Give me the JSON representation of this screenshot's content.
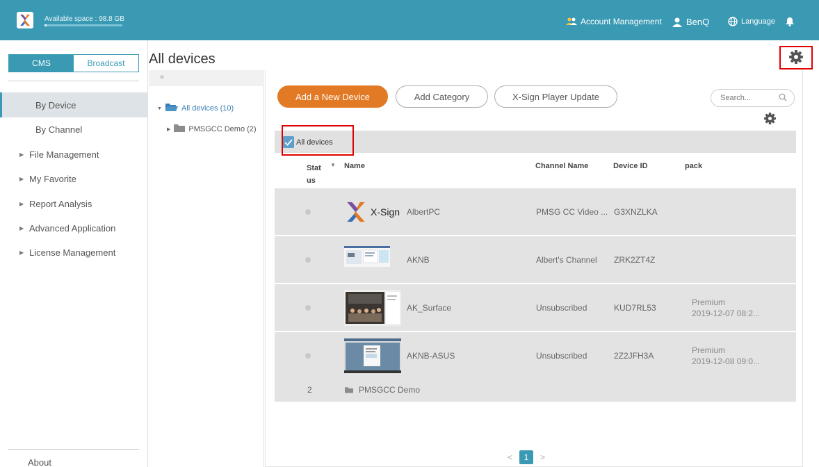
{
  "topbar": {
    "available_space": "Available space : 98.8 GB",
    "space_used_fraction": 0.03,
    "account_management": "Account Management",
    "user": "BenQ",
    "language": "Language",
    "colors": {
      "bar": "#3a9ab4",
      "accent": "#e27924"
    },
    "icons": {
      "logo": "x-sign-logo-icon",
      "account": "users-icon",
      "user": "person-icon",
      "language": "globe-icon",
      "notification": "bell-icon"
    }
  },
  "sidebar": {
    "tabs": {
      "cms": "CMS",
      "broadcast": "Broadcast"
    },
    "items": [
      {
        "label": "By Device",
        "active": true,
        "expandable": false
      },
      {
        "label": "By Channel",
        "active": false,
        "expandable": false
      },
      {
        "label": "File Management",
        "active": false,
        "expandable": true
      },
      {
        "label": "My Favorite",
        "active": false,
        "expandable": true
      },
      {
        "label": "Report Analysis",
        "active": false,
        "expandable": true
      },
      {
        "label": "Advanced Application",
        "active": false,
        "expandable": true
      },
      {
        "label": "License Management",
        "active": false,
        "expandable": true
      }
    ],
    "about": "About"
  },
  "main": {
    "title": "All devices",
    "collapse": "«",
    "tree": [
      {
        "label": "All devices (10)",
        "expanded": true
      },
      {
        "label": "PMSGCC Demo (2)",
        "expanded": false
      }
    ],
    "buttons": {
      "add_device": "Add a New Device",
      "add_category": "Add Category",
      "player_update": "X-Sign Player Update"
    },
    "search_placeholder": "Search...",
    "all_devices_checkbox": "All devices",
    "columns": {
      "status": "Stat us",
      "name": "Name",
      "channel": "Channel Name",
      "device_id": "Device ID",
      "pack": "pack"
    },
    "rows": [
      {
        "name": "AlbertPC",
        "channel": "PMSG CC Video ...",
        "device_id": "G3XNZLKA",
        "pack": "",
        "pack_date": "",
        "thumb": "xsign"
      },
      {
        "name": "AKNB",
        "channel": "Albert's Channel",
        "device_id": "ZRK2ZT4Z",
        "pack": "",
        "pack_date": "",
        "thumb": "screen"
      },
      {
        "name": "AK_Surface",
        "channel": "Unsubscribed",
        "device_id": "KUD7RL53",
        "pack": "Premium",
        "pack_date": "2019-12-07 08:2...",
        "thumb": "photo"
      },
      {
        "name": "AKNB-ASUS",
        "channel": "Unsubscribed",
        "device_id": "2Z2JFH3A",
        "pack": "Premium",
        "pack_date": "2019-12-08 09:0...",
        "thumb": "desktop"
      }
    ],
    "group_row": {
      "count": "2",
      "name": "PMSGCC Demo"
    },
    "thumb_logo_text": "X-Sign",
    "pager": {
      "prev": "<",
      "current": "1",
      "next": ">"
    }
  }
}
